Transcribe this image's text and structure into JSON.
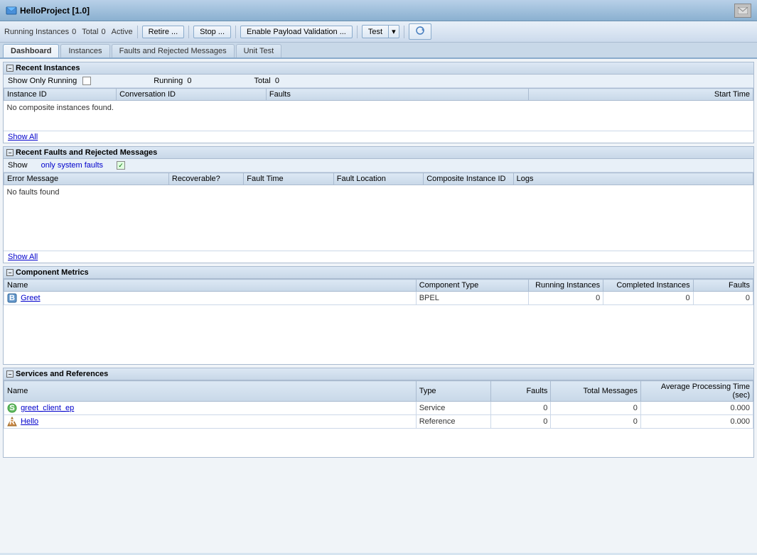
{
  "titlebar": {
    "title": "HelloProject [1.0]",
    "action_icon": "envelope-icon"
  },
  "toolbar": {
    "running_instances_label": "Running Instances",
    "running_instances_value": "0",
    "total_label": "Total",
    "total_value": "0",
    "active_label": "Active",
    "retire_btn": "Retire ...",
    "stop_btn": "Stop ...",
    "enable_payload_btn": "Enable Payload Validation ...",
    "test_btn": "Test",
    "refresh_icon": "refresh-icon"
  },
  "tabs": [
    {
      "id": "dashboard",
      "label": "Dashboard",
      "active": true
    },
    {
      "id": "instances",
      "label": "Instances",
      "active": false
    },
    {
      "id": "faults",
      "label": "Faults and Rejected Messages",
      "active": false
    },
    {
      "id": "unittest",
      "label": "Unit Test",
      "active": false
    }
  ],
  "recent_instances": {
    "title": "Recent Instances",
    "filter": {
      "show_only_running_label": "Show Only Running",
      "running_label": "Running",
      "running_value": "0",
      "total_label": "Total",
      "total_value": "0"
    },
    "columns": [
      "Instance ID",
      "Conversation ID",
      "Faults",
      "Start Time"
    ],
    "no_data_message": "No composite instances found.",
    "show_all_label": "Show All"
  },
  "recent_faults": {
    "title": "Recent Faults and Rejected Messages",
    "filter": {
      "show_label": "Show",
      "only_system_faults_label": "only system faults",
      "checkbox_checked": true
    },
    "columns": [
      "Error Message",
      "Recoverable?",
      "Fault Time",
      "Fault Location",
      "Composite Instance ID",
      "Logs"
    ],
    "no_data_message": "No faults found",
    "show_all_label": "Show All"
  },
  "component_metrics": {
    "title": "Component Metrics",
    "columns": [
      "Name",
      "Component Type",
      "Running Instances",
      "Completed Instances",
      "Faults"
    ],
    "rows": [
      {
        "name": "Greet",
        "type": "BPEL",
        "running": "0",
        "completed": "0",
        "faults": "0"
      }
    ]
  },
  "services_references": {
    "title": "Services and References",
    "columns": [
      "Name",
      "Type",
      "Faults",
      "Total Messages",
      "Average Processing Time (sec)"
    ],
    "rows": [
      {
        "name": "greet_client_ep",
        "type": "Service",
        "faults": "0",
        "total": "0",
        "avg_time": "0.000"
      },
      {
        "name": "Hello",
        "type": "Reference",
        "faults": "0",
        "total": "0",
        "avg_time": "0.000"
      }
    ]
  }
}
